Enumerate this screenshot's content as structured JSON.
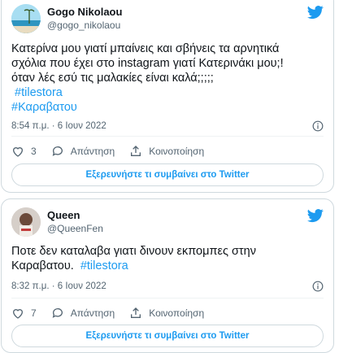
{
  "colors": {
    "accent": "#1d9bf0",
    "text": "#0f1419",
    "muted": "#536471",
    "border": "#cfd9de"
  },
  "tweets": [
    {
      "name": "Gogo Nikolaou",
      "handle": "@gogo_nikolaou",
      "lines": [
        "Κατερίνα μου γιατί μπαίνεις και σβήνεις τα αρνητικά",
        "σχόλια που έχει στο instagram γιατί Κατερινάκι μου;!",
        "όταν λές εσύ τις μαλακίες είναι καλά;;;;;"
      ],
      "hashtags": [
        "#tilestora",
        "#Καραβατου"
      ],
      "time": "8:54 π.μ. · 6 Ιουν 2022",
      "likes": "3",
      "reply_label": "Απάντηση",
      "share_label": "Κοινοποίηση",
      "cta": "Εξερευνήστε τι συμβαίνει στο Twitter"
    },
    {
      "name": "Queen",
      "handle": "@QueenFen",
      "lines": [
        "Ποτε δεν καταλαβα γιατι δινουν εκπομπες στην",
        "Καραβατου."
      ],
      "hashtags": [
        "#tilestora"
      ],
      "time": "8:32 π.μ. · 6 Ιουν 2022",
      "likes": "7",
      "reply_label": "Απάντηση",
      "share_label": "Κοινοποίηση",
      "cta": "Εξερευνήστε τι συμβαίνει στο Twitter"
    }
  ]
}
